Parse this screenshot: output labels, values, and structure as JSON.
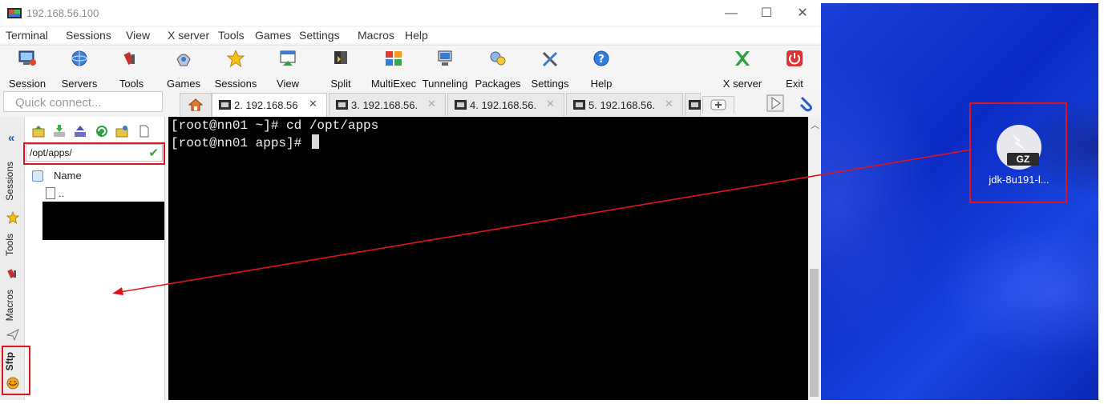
{
  "window": {
    "title": "192.168.56.100",
    "controls": {
      "minimize": "—",
      "maximize": "☐",
      "close": "✕"
    }
  },
  "menu": [
    "Terminal",
    "Sessions",
    "View",
    "X server",
    "Tools",
    "Games",
    "Settings",
    "Macros",
    "Help"
  ],
  "toolbar": [
    {
      "label": "Session",
      "icon": "session-icon"
    },
    {
      "label": "Servers",
      "icon": "servers-icon"
    },
    {
      "label": "Tools",
      "icon": "tools-icon"
    },
    {
      "label": "Games",
      "icon": "games-icon"
    },
    {
      "label": "Sessions",
      "icon": "sessions-star-icon"
    },
    {
      "label": "View",
      "icon": "view-icon"
    },
    {
      "label": "Split",
      "icon": "split-icon"
    },
    {
      "label": "MultiExec",
      "icon": "multiexec-icon"
    },
    {
      "label": "Tunneling",
      "icon": "tunneling-icon"
    },
    {
      "label": "Packages",
      "icon": "packages-icon"
    },
    {
      "label": "Settings",
      "icon": "settings-icon"
    },
    {
      "label": "Help",
      "icon": "help-icon"
    },
    {
      "label": "X server",
      "icon": "xserver-icon"
    },
    {
      "label": "Exit",
      "icon": "exit-icon"
    }
  ],
  "quick_connect": {
    "placeholder": "Quick connect..."
  },
  "tabs": [
    {
      "label": "2. 192.168.56",
      "active": true
    },
    {
      "label": "3. 192.168.56.",
      "active": false
    },
    {
      "label": "4. 192.168.56.",
      "active": false
    },
    {
      "label": "5. 192.168.56.",
      "active": false
    }
  ],
  "side_tabs": [
    "Sessions",
    "Tools",
    "Macros",
    "Sftp"
  ],
  "sftp": {
    "path": "/opt/apps/",
    "column_name": "Name",
    "rows": [
      ".."
    ]
  },
  "terminal": {
    "lines": [
      "[root@nn01 ~]# cd /opt/apps",
      "[root@nn01 apps]# "
    ]
  },
  "desktop": {
    "file": {
      "badge": "GZ",
      "label": "jdk-8u191-l..."
    }
  },
  "colors": {
    "annotation": "#e0151b",
    "terminal_bg": "#000000",
    "desktop_blue": "#1b3fd6"
  }
}
